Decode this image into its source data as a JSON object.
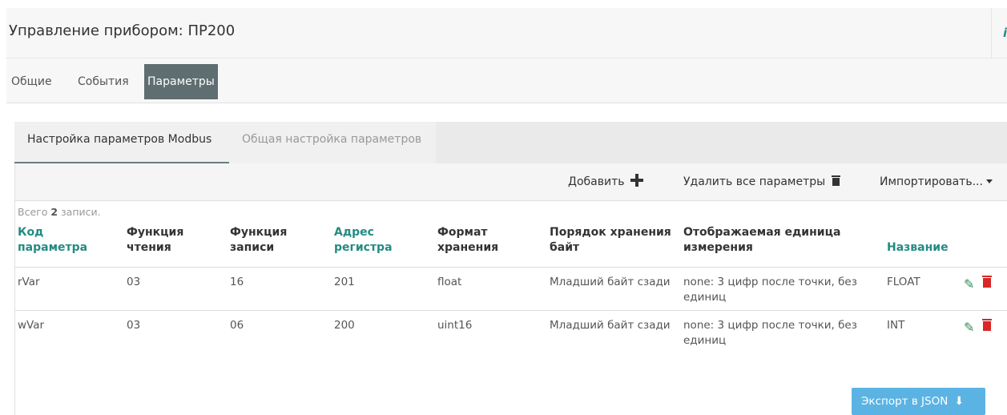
{
  "header": {
    "title": "Управление прибором: ПР200",
    "right_icon": "info-icon"
  },
  "top_tabs": [
    {
      "label": "Общие"
    },
    {
      "label": "События"
    },
    {
      "label": "Параметры"
    }
  ],
  "sub_tabs": [
    {
      "label": "Настройка параметров Modbus"
    },
    {
      "label": "Общая настройка параметров"
    }
  ],
  "toolbar": {
    "add_label": "Добавить",
    "delete_all_label": "Удалить все параметры",
    "import_label": "Импортировать..."
  },
  "summary": {
    "prefix": "Всего",
    "count": "2",
    "suffix": "записи."
  },
  "table": {
    "columns": [
      {
        "label": "Код параметра"
      },
      {
        "label": "Функция чтения"
      },
      {
        "label": "Функция записи"
      },
      {
        "label": "Адрес регистра"
      },
      {
        "label": "Формат хранения"
      },
      {
        "label": "Порядок хранения байт"
      },
      {
        "label": "Отображаемая единица измерения"
      },
      {
        "label": "Название"
      }
    ],
    "rows": [
      {
        "code": "rVar",
        "read_fn": "03",
        "write_fn": "16",
        "address": "201",
        "format": "float",
        "byte_order": "Младший байт сзади",
        "unit": "none: 3 цифр после точки, без единиц",
        "name": "FLOAT"
      },
      {
        "code": "wVar",
        "read_fn": "03",
        "write_fn": "06",
        "address": "200",
        "format": "uint16",
        "byte_order": "Младший байт сзади",
        "unit": "none: 3 цифр после точки, без единиц",
        "name": "INT"
      }
    ]
  },
  "export_label": "Экспорт в JSON",
  "colors": {
    "active_tab": "#5f6e70",
    "sort_link": "#238b82",
    "delete": "#d92626",
    "export": "#5bb3e3"
  }
}
